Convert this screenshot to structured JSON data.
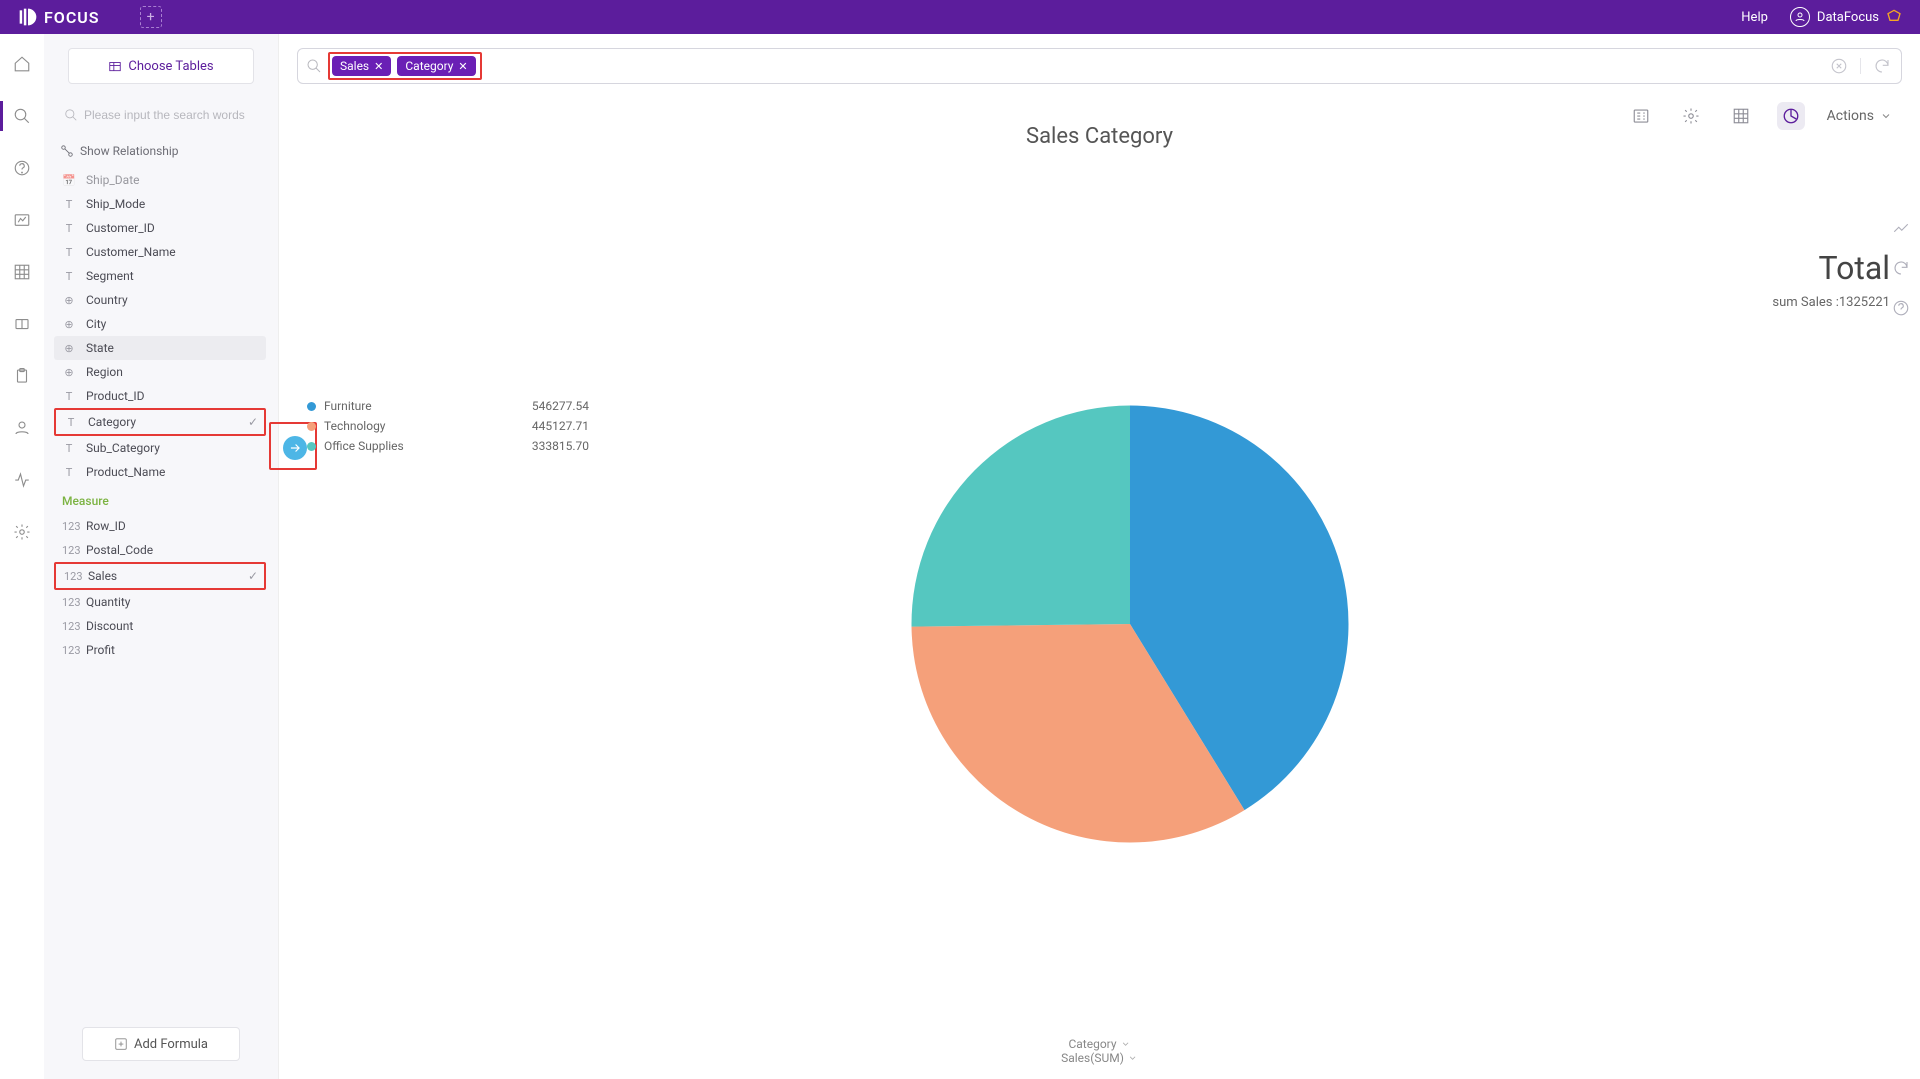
{
  "app_name": "FOCUS",
  "topbar": {
    "help": "Help",
    "user": "DataFocus"
  },
  "sidebar": {
    "choose_tables": "Choose Tables",
    "search_placeholder": "Please input the search words",
    "show_relationship": "Show Relationship",
    "add_formula": "Add Formula",
    "measure_label": "Measure",
    "fields": [
      {
        "icon": "cal",
        "label": "Ship_Date"
      },
      {
        "icon": "T",
        "label": "Ship_Mode"
      },
      {
        "icon": "T",
        "label": "Customer_ID"
      },
      {
        "icon": "T",
        "label": "Customer_Name"
      },
      {
        "icon": "T",
        "label": "Segment"
      },
      {
        "icon": "globe",
        "label": "Country"
      },
      {
        "icon": "globe",
        "label": "City"
      },
      {
        "icon": "globe",
        "label": "State"
      },
      {
        "icon": "globe",
        "label": "Region"
      },
      {
        "icon": "T",
        "label": "Product_ID"
      },
      {
        "icon": "T",
        "label": "Category"
      },
      {
        "icon": "T",
        "label": "Sub_Category"
      },
      {
        "icon": "T",
        "label": "Product_Name"
      }
    ],
    "measures": [
      {
        "label": "Row_ID"
      },
      {
        "label": "Postal_Code"
      },
      {
        "label": "Sales"
      },
      {
        "label": "Quantity"
      },
      {
        "label": "Discount"
      },
      {
        "label": "Profit"
      }
    ]
  },
  "query": {
    "chips": [
      {
        "label": "Sales"
      },
      {
        "label": "Category"
      }
    ]
  },
  "toolbar": {
    "actions": "Actions"
  },
  "chart_title": "Sales Category",
  "summary": {
    "title": "Total",
    "sub": "sum Sales :1325221"
  },
  "axis": {
    "cat": "Category",
    "val": "Sales(SUM)"
  },
  "chart_data": {
    "type": "pie",
    "title": "Sales Category",
    "series": [
      {
        "name": "Furniture",
        "value": 546277.54,
        "color": "#3399d6"
      },
      {
        "name": "Technology",
        "value": 445127.71,
        "color": "#f5a07a"
      },
      {
        "name": "Office Supplies",
        "value": 333815.7,
        "color": "#55c7c0"
      }
    ],
    "total": 1325221
  },
  "legend_vals": [
    "546277.54",
    "445127.71",
    "333815.70"
  ]
}
